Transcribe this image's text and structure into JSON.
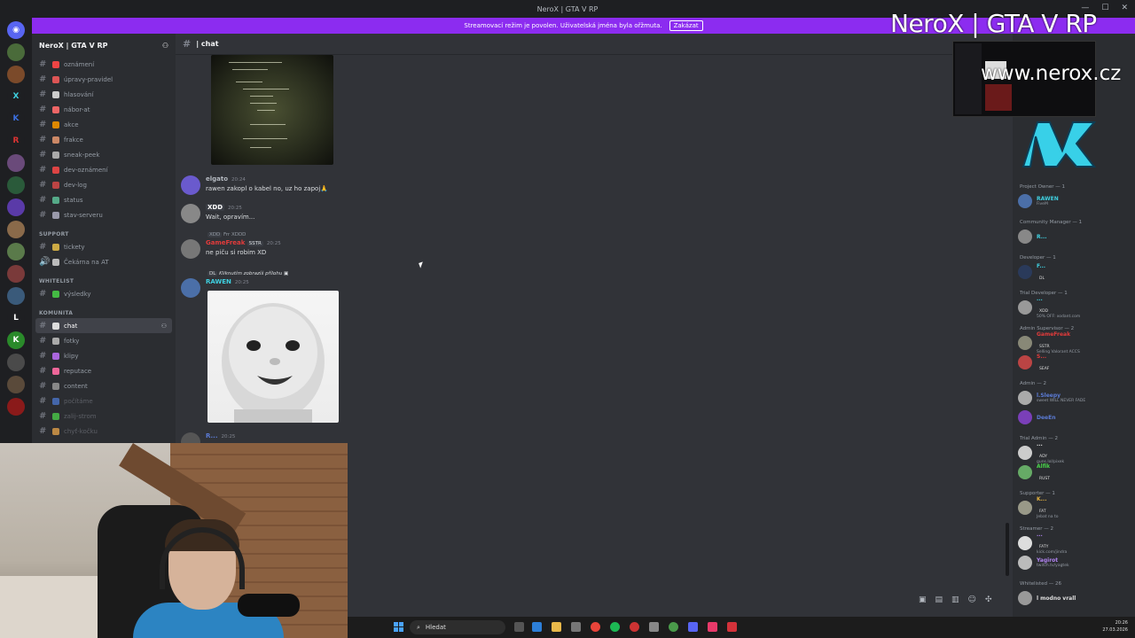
{
  "window": {
    "title": "NeroX | GTA V RP"
  },
  "notice": {
    "text": "Streamovací režim je povolen. Uživatelská jména byla ořžmuta.",
    "button": "Zakázat"
  },
  "server": {
    "name": "NeroX | GTA V RP"
  },
  "channels": {
    "top": [
      {
        "label": "oznámení",
        "color": "#e44"
      },
      {
        "label": "úpravy-pravidel",
        "color": "#d55"
      },
      {
        "label": "hlasování",
        "color": "#ccc"
      },
      {
        "label": "nábor-at",
        "color": "#e66"
      },
      {
        "label": "akce",
        "color": "#d80"
      },
      {
        "label": "frakce",
        "color": "#c86"
      },
      {
        "label": "sneak-peek",
        "color": "#aaa"
      },
      {
        "label": "dev-oznámení",
        "color": "#d44"
      },
      {
        "label": "dev-log",
        "color": "#b44"
      },
      {
        "label": "status",
        "color": "#5a8"
      },
      {
        "label": "stav-serveru",
        "color": "#99a"
      }
    ],
    "support_category": "SUPPORT",
    "support": [
      {
        "label": "tickety",
        "color": "#ca4",
        "type": "text"
      },
      {
        "label": "Čekárna na AT",
        "color": "#bbb",
        "type": "voice"
      }
    ],
    "whitelist_category": "WHITELIST",
    "whitelist": [
      {
        "label": "výsledky",
        "color": "#4b4"
      }
    ],
    "komunita_category": "KOMUNITA",
    "komunita": [
      {
        "label": "chat",
        "color": "#ddd",
        "active": true
      },
      {
        "label": "fotky",
        "color": "#aaa"
      },
      {
        "label": "klipy",
        "color": "#a6d"
      },
      {
        "label": "reputace",
        "color": "#e69"
      },
      {
        "label": "content",
        "color": "#888"
      },
      {
        "label": "počítáme",
        "color": "#46a",
        "dim": true
      },
      {
        "label": "zalij-strom",
        "color": "#4a4",
        "dim": true
      },
      {
        "label": "chyť-kočku",
        "color": "#b84",
        "dim": true
      }
    ]
  },
  "chat": {
    "channel": "| chat",
    "messages": [
      {
        "name": "elgato",
        "name_color": "#b5bac1",
        "time": "20:24",
        "text": "rawen zakopl o kabel no, uz ho zapoj🙏",
        "avatar": "#6a5acd"
      },
      {
        "name": "",
        "badge": "XDD",
        "time": "20:25",
        "text": "Wait, opravím...",
        "avatar": "#888"
      },
      {
        "reply": "Frr XDDD",
        "reply_badge": "XDD",
        "name": "GameFreak",
        "badge": "SSTR",
        "time": "20:25",
        "text": "ne piču si robim XD",
        "avatar": "#777"
      },
      {
        "reply": "Kliknutím zobrazíš přílohu",
        "reply_badge": "DL",
        "name": "RAWEN",
        "name_color": "#3fd0e0",
        "time": "20:25",
        "text": "",
        "avatar": "#4b6fa8"
      },
      {
        "name": "R...",
        "time": "20:25",
        "text": "",
        "avatar": "#555"
      }
    ]
  },
  "members": {
    "groups": [
      {
        "role": "Project Owner — 1",
        "items": [
          {
            "name": "RAWEN",
            "color": "#3fd0e0",
            "status": "FiveM",
            "avatar": "#4b6fa8"
          }
        ]
      },
      {
        "role": "Community Manager — 1",
        "items": [
          {
            "name": "R...",
            "color": "#3fd0e0",
            "status": "",
            "avatar": "#888"
          }
        ]
      },
      {
        "role": "Developer — 1",
        "items": [
          {
            "name": "F...",
            "color": "#3fd0e0",
            "status": "",
            "badge": "DL",
            "avatar": "#2a3a5a"
          }
        ]
      },
      {
        "role": "Trial Developer — 1",
        "items": [
          {
            "name": "...",
            "color": "#3fd0e0",
            "badge": "XDD",
            "status": "50% OFF: xodant.com",
            "avatar": "#999"
          }
        ]
      },
      {
        "role": "Admin Supervisor — 2",
        "items": [
          {
            "name": "GameFreak",
            "color": "#e23b3b",
            "badge": "SSTR",
            "status": "Selling Valorant ACCS",
            "avatar": "#887"
          },
          {
            "name": "S...",
            "color": "#e23b3b",
            "badge": "SEAF",
            "status": "",
            "avatar": "#b44"
          }
        ]
      },
      {
        "role": "Admin — 2",
        "items": [
          {
            "name": "l.Sleepy",
            "color": "#5b7bd5",
            "status": "sweet WILL NEVER FADE",
            "avatar": "#aaa"
          },
          {
            "name": "DeeEn",
            "color": "#5b7bd5",
            "status": "",
            "avatar": "#7a3fb8"
          }
        ]
      },
      {
        "role": "Trial Admin — 2",
        "items": [
          {
            "name": "...",
            "color": "#e0e0e0",
            "badge": "ADY",
            "status": "guns.lol/pixek",
            "avatar": "#ccc"
          },
          {
            "name": "Alfik",
            "color": "#49d14a",
            "badge": "RUST",
            "status": "",
            "avatar": "#6a6"
          }
        ]
      },
      {
        "role": "Supporter — 1",
        "items": [
          {
            "name": "K...",
            "color": "#e0b040",
            "badge": "FAT",
            "status": "Jebat na to",
            "avatar": "#998"
          }
        ]
      },
      {
        "role": "Streamer — 2",
        "items": [
          {
            "name": "...",
            "color": "#b083f0",
            "badge": "FATY",
            "status": "kick.com/jindra",
            "avatar": "#ddd"
          },
          {
            "name": "Yagirot",
            "color": "#b083f0",
            "status": "twitch.tv/yagtek",
            "avatar": "#bbb"
          }
        ]
      },
      {
        "role": "Whitelisted — 26",
        "items": [
          {
            "name": "l modno vrall",
            "color": "#ddd",
            "status": "",
            "avatar": "#999"
          }
        ]
      }
    ]
  },
  "overlay": {
    "title": "NeroX | GTA V RP",
    "url": "www.nerox.cz"
  },
  "taskbar": {
    "search": "Hledat",
    "time": "20:26",
    "date": "27.03.2026"
  },
  "icons": [
    "discord-icon",
    "search-icon",
    "windows-icon",
    "gear-icon"
  ]
}
